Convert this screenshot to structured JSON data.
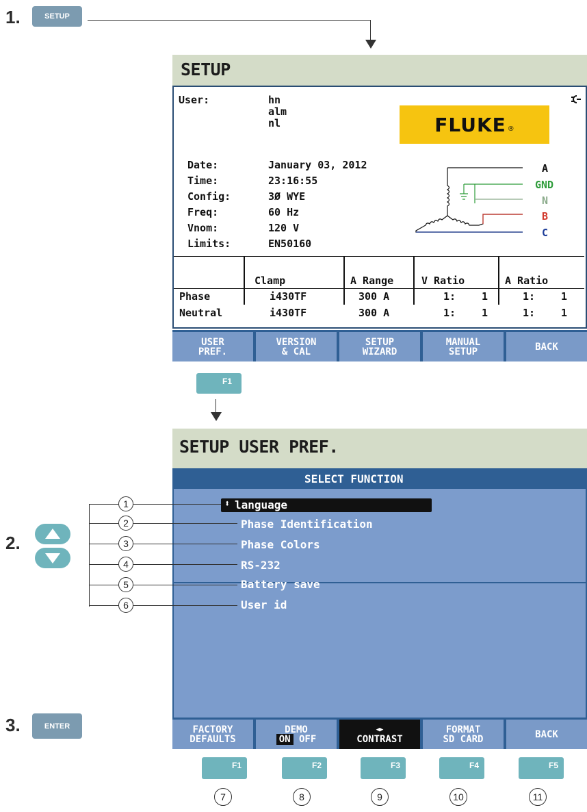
{
  "steps": {
    "one": "1.",
    "two": "2.",
    "three": "3."
  },
  "keys": {
    "setup": "SETUP",
    "enter": "ENTER",
    "f1_top": "F1",
    "f_row": [
      "F1",
      "F2",
      "F3",
      "F4",
      "F5"
    ]
  },
  "setup_screen": {
    "title": "SETUP",
    "user_label": "User:",
    "user_lines": [
      "hn",
      "alm",
      "nl"
    ],
    "brand": "FLUKE",
    "brand_mark": "®",
    "fields": [
      {
        "label": "Date:",
        "value": "January 03, 2012"
      },
      {
        "label": "Time:",
        "value": "23:16:55"
      },
      {
        "label": "Config:",
        "value": "3Ø WYE"
      },
      {
        "label": "Freq:",
        "value": "60 Hz"
      },
      {
        "label": "Vnom:",
        "value": "120 V"
      },
      {
        "label": "Limits:",
        "value": "EN50160"
      }
    ],
    "wiring_labels": [
      "A",
      "GND",
      "N",
      "B",
      "C"
    ],
    "wiring_colors": {
      "A": "#111111",
      "GND": "#2e9c3a",
      "N": "#8aaa8a",
      "B": "#d23a2e",
      "C": "#1f3f9a"
    },
    "table": {
      "headers": [
        "",
        "Clamp",
        "A Range",
        "V Ratio",
        "A Ratio"
      ],
      "rows": [
        [
          "Phase",
          "i430TF",
          "300 A",
          "1:",
          "1",
          "1:",
          "1"
        ],
        [
          "Neutral",
          "i430TF",
          "300 A",
          "1:",
          "1",
          "1:",
          "1"
        ]
      ]
    },
    "softkeys": [
      [
        "USER",
        "PREF."
      ],
      [
        "VERSION",
        "& CAL"
      ],
      [
        "SETUP",
        "WIZARD"
      ],
      [
        "MANUAL",
        "SETUP"
      ],
      [
        "BACK",
        ""
      ]
    ]
  },
  "pref_screen": {
    "title": "SETUP USER PREF.",
    "header": "SELECT FUNCTION",
    "selected_glyph": "⬍",
    "items": [
      "language",
      "Phase Identification",
      "Phase Colors",
      "RS-232",
      "Battery save",
      "User id"
    ],
    "item_numbers": [
      "1",
      "2",
      "3",
      "4",
      "5",
      "6"
    ],
    "softkeys": {
      "factory": [
        "FACTORY",
        "DEFAULTS"
      ],
      "demo_title": "DEMO",
      "demo_on": "ON",
      "demo_off": "OFF",
      "contrast_glyph": "◀▶",
      "contrast": "CONTRAST",
      "format": [
        "FORMAT",
        "SD CARD"
      ],
      "back": "BACK"
    },
    "bottom_numbers": [
      "7",
      "8",
      "9",
      "10",
      "11"
    ]
  }
}
